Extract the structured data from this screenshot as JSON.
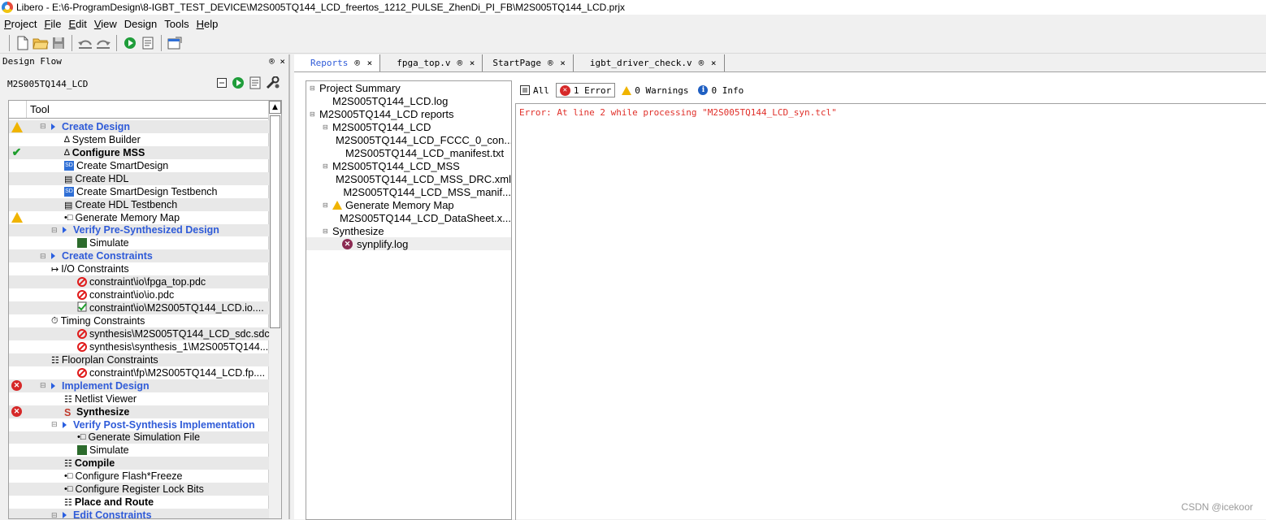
{
  "window": {
    "app": "Libero",
    "title": "Libero - E:\\6-ProgramDesign\\8-IGBT_TEST_DEVICE\\M2S005TQ144_LCD_freertos_1212_PULSE_ZhenDi_PI_FB\\M2S005TQ144_LCD.prjx"
  },
  "menu": [
    {
      "label": "Project",
      "key": "P",
      "rest": "roject"
    },
    {
      "label": "File",
      "key": "F",
      "rest": "ile"
    },
    {
      "label": "Edit",
      "key": "E",
      "rest": "dit"
    },
    {
      "label": "View",
      "key": "V",
      "rest": "iew"
    },
    {
      "label": "Design",
      "key": "",
      "rest": "Design"
    },
    {
      "label": "Tools",
      "key": "",
      "rest": "Tools"
    },
    {
      "label": "Help",
      "key": "H",
      "rest": "elp"
    }
  ],
  "left_panel": {
    "title": "Design Flow",
    "controls": "® ×",
    "project_name": "M2S005TQ144_LCD",
    "column_header": "Tool",
    "rows": [
      {
        "label": "Create Design",
        "status": "warn",
        "style": "link",
        "indent": 0,
        "arrow": true
      },
      {
        "label": "System Builder",
        "status": "",
        "style": "",
        "indent": 2,
        "icon": "∆"
      },
      {
        "label": "Configure MSS",
        "status": "ok",
        "style": "bold",
        "indent": 2,
        "icon": "∆"
      },
      {
        "label": "Create SmartDesign",
        "status": "",
        "style": "",
        "indent": 2,
        "icon": "SD"
      },
      {
        "label": "Create HDL",
        "status": "",
        "style": "",
        "indent": 2,
        "icon": "▤"
      },
      {
        "label": "Create SmartDesign Testbench",
        "status": "",
        "style": "",
        "indent": 2,
        "icon": "SD"
      },
      {
        "label": "Create HDL Testbench",
        "status": "",
        "style": "",
        "indent": 2,
        "icon": "▤"
      },
      {
        "label": "Generate Memory Map",
        "status": "warn",
        "style": "",
        "indent": 2,
        "icon": "•□"
      },
      {
        "label": "Verify Pre-Synthesized Design",
        "status": "",
        "style": "link",
        "indent": 1,
        "arrow": true
      },
      {
        "label": "Simulate",
        "status": "",
        "style": "",
        "indent": 3,
        "icon": "▩"
      },
      {
        "label": "Create Constraints",
        "status": "",
        "style": "link",
        "indent": 0,
        "arrow": true
      },
      {
        "label": "I/O Constraints",
        "status": "",
        "style": "",
        "indent": 1,
        "icon": "↦"
      },
      {
        "label": "constraint\\io\\fpga_top.pdc",
        "status": "",
        "style": "",
        "indent": 3,
        "icon": "no"
      },
      {
        "label": "constraint\\io\\io.pdc",
        "status": "",
        "style": "",
        "indent": 3,
        "icon": "no"
      },
      {
        "label": "constraint\\io\\M2S005TQ144_LCD.io....",
        "status": "",
        "style": "",
        "indent": 3,
        "icon": "check"
      },
      {
        "label": "Timing Constraints",
        "status": "",
        "style": "",
        "indent": 1,
        "icon": "⏱"
      },
      {
        "label": "synthesis\\M2S005TQ144_LCD_sdc.sdc",
        "status": "",
        "style": "",
        "indent": 3,
        "icon": "no"
      },
      {
        "label": "synthesis\\synthesis_1\\M2S005TQ144...",
        "status": "",
        "style": "",
        "indent": 3,
        "icon": "no"
      },
      {
        "label": "Floorplan Constraints",
        "status": "",
        "style": "",
        "indent": 1,
        "icon": "☷"
      },
      {
        "label": "constraint\\fp\\M2S005TQ144_LCD.fp....",
        "status": "",
        "style": "",
        "indent": 3,
        "icon": "no"
      },
      {
        "label": "Implement Design",
        "status": "err",
        "style": "link",
        "indent": 0,
        "arrow": true
      },
      {
        "label": "Netlist Viewer",
        "status": "",
        "style": "",
        "indent": 2,
        "icon": "☷"
      },
      {
        "label": "Synthesize",
        "status": "err",
        "style": "bold",
        "indent": 2,
        "icon": "S"
      },
      {
        "label": "Verify Post-Synthesis Implementation",
        "status": "",
        "style": "link",
        "indent": 1,
        "arrow": true
      },
      {
        "label": "Generate Simulation File",
        "status": "",
        "style": "",
        "indent": 3,
        "icon": "•□"
      },
      {
        "label": "Simulate",
        "status": "",
        "style": "",
        "indent": 3,
        "icon": "▩"
      },
      {
        "label": "Compile",
        "status": "",
        "style": "bold",
        "indent": 2,
        "icon": "☷"
      },
      {
        "label": "Configure Flash*Freeze",
        "status": "",
        "style": "",
        "indent": 2,
        "icon": "•□"
      },
      {
        "label": "Configure Register Lock Bits",
        "status": "",
        "style": "",
        "indent": 2,
        "icon": "•□"
      },
      {
        "label": "Place and Route",
        "status": "",
        "style": "bold",
        "indent": 2,
        "icon": "☷"
      },
      {
        "label": "Edit Constraints",
        "status": "",
        "style": "link",
        "indent": 1,
        "arrow": true
      }
    ]
  },
  "tabs": [
    {
      "label": "Reports",
      "active": true
    },
    {
      "label": "fpga_top.v",
      "active": false
    },
    {
      "label": "StartPage",
      "active": false
    },
    {
      "label": "igbt_driver_check.v",
      "active": false
    }
  ],
  "tab_controls": "® ×",
  "report_tree": [
    {
      "label": "Project Summary",
      "level": 0,
      "exp": "⊟"
    },
    {
      "label": "M2S005TQ144_LCD.log",
      "level": 1
    },
    {
      "label": "M2S005TQ144_LCD reports",
      "level": 0,
      "exp": "⊟"
    },
    {
      "label": "M2S005TQ144_LCD",
      "level": 1,
      "exp": "⊟"
    },
    {
      "label": "M2S005TQ144_LCD_FCCC_0_con...",
      "level": 2
    },
    {
      "label": "M2S005TQ144_LCD_manifest.txt",
      "level": 2
    },
    {
      "label": "M2S005TQ144_LCD_MSS",
      "level": 1,
      "exp": "⊟"
    },
    {
      "label": "M2S005TQ144_LCD_MSS_DRC.xml",
      "level": 2
    },
    {
      "label": "M2S005TQ144_LCD_MSS_manif...",
      "level": 2
    },
    {
      "label": "Generate Memory Map",
      "level": 1,
      "exp": "⊟",
      "icon": "warn"
    },
    {
      "label": "M2S005TQ144_LCD_DataSheet.x...",
      "level": 2
    },
    {
      "label": "Synthesize",
      "level": 1,
      "exp": "⊟"
    },
    {
      "label": "synplify.log",
      "level": 2,
      "icon": "err",
      "selected": true
    }
  ],
  "filters": {
    "all": "All",
    "error": "1 Error",
    "warnings": "0 Warnings",
    "info": "0 Info"
  },
  "messages": {
    "error_text": "Error: At line 2 while processing \"M2S005TQ144_LCD_syn.tcl\""
  },
  "watermark": "CSDN @icekoor",
  "colors": {
    "link": "#2f5bd8",
    "error": "#e0302a",
    "warning": "#f0b400",
    "ok": "#1e9e2c"
  }
}
